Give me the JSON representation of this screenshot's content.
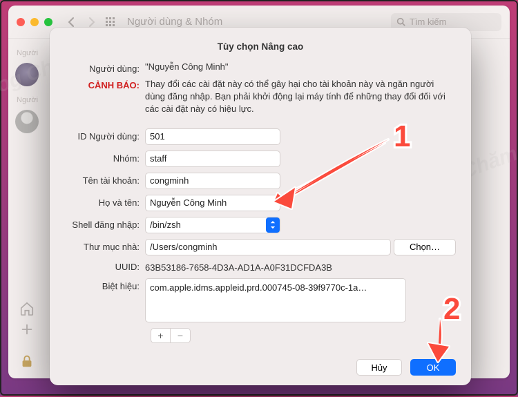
{
  "window": {
    "title": "Người dùng & Nhóm",
    "search_placeholder": "Tìm kiếm"
  },
  "sidebar": {
    "group1_label": "Người",
    "group2_label": "Người"
  },
  "sheet": {
    "title": "Tùy chọn Nâng cao",
    "user_label": "Người dùng:",
    "user_value": "\"Nguyễn Công Minh\"",
    "warning_label": "CẢNH BÁO:",
    "warning_text": "Thay đổi các cài đặt này có thể gây hại cho tài khoản này và ngăn người dùng đăng nhập. Bạn phải khởi động lại máy tính để những thay đổi đối với các cài đặt này có hiệu lực.",
    "fields": {
      "userid_label": "ID Người dùng:",
      "userid_value": "501",
      "group_label": "Nhóm:",
      "group_value": "staff",
      "account_label": "Tên tài khoản:",
      "account_value": "congminh",
      "fullname_label": "Họ và tên:",
      "fullname_value": "Nguyễn Công Minh",
      "shell_label": "Shell đăng nhập:",
      "shell_value": "/bin/zsh",
      "homedir_label": "Thư mục nhà:",
      "homedir_value": "/Users/congminh",
      "choose_label": "Chọn…",
      "uuid_label": "UUID:",
      "uuid_value": "63B53186-7658-4D3A-AD1A-A0F31DCFDA3B",
      "aliases_label": "Biệt hiệu:",
      "aliases_value": "com.apple.idms.appleid.prd.000745-08-39f9770c-1a…"
    },
    "plus": "+",
    "minus": "−",
    "cancel": "Hủy",
    "ok": "OK"
  },
  "annotations": {
    "one": "1",
    "two": "2"
  },
  "watermark": "Blog Chăm Chỉ"
}
